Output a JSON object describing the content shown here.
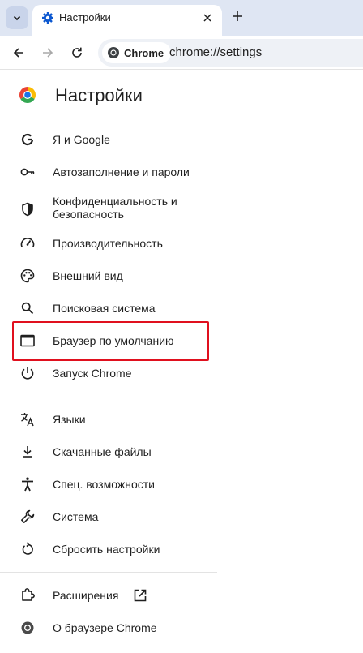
{
  "browser": {
    "tab": {
      "title": "Настройки"
    },
    "omnibox": {
      "chip_label": "Chrome",
      "url": "chrome://settings"
    }
  },
  "settings": {
    "title": "Настройки",
    "menu": [
      {
        "label": "Я и Google",
        "icon": "google-g-icon"
      },
      {
        "label": "Автозаполнение и пароли",
        "icon": "key-icon"
      },
      {
        "label": "Конфиденциальность и безопасность",
        "icon": "shield-icon"
      },
      {
        "label": "Производительность",
        "icon": "speedometer-icon"
      },
      {
        "label": "Внешний вид",
        "icon": "palette-icon"
      },
      {
        "label": "Поисковая система",
        "icon": "search-icon"
      },
      {
        "label": "Браузер по умолчанию",
        "icon": "browser-window-icon"
      },
      {
        "label": "Запуск Chrome",
        "icon": "power-icon"
      },
      {
        "label": "Языки",
        "icon": "translate-icon"
      },
      {
        "label": "Скачанные файлы",
        "icon": "download-icon"
      },
      {
        "label": "Спец. возможности",
        "icon": "accessibility-icon"
      },
      {
        "label": "Система",
        "icon": "wrench-icon"
      },
      {
        "label": "Сбросить настройки",
        "icon": "reset-icon"
      },
      {
        "label": "Расширения",
        "icon": "puzzle-icon"
      },
      {
        "label": "О браузере Chrome",
        "icon": "chrome-logo-icon"
      }
    ]
  },
  "colors": {
    "tabstrip": "#dfe6f3",
    "highlight_border": "#e0101e",
    "accent": "#0b57d0"
  }
}
